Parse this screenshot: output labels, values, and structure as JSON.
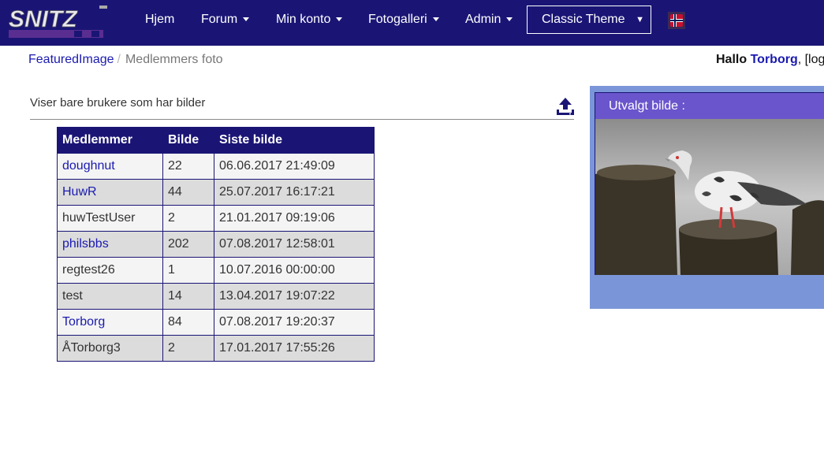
{
  "navbar": {
    "logo_text": "SNITZ",
    "items": [
      {
        "label": "Hjem",
        "has_caret": false
      },
      {
        "label": "Forum",
        "has_caret": true
      },
      {
        "label": "Min konto",
        "has_caret": true
      },
      {
        "label": "Fotogalleri",
        "has_caret": true
      },
      {
        "label": "Admin",
        "has_caret": true
      }
    ],
    "theme_select": {
      "value": "Classic Theme",
      "arrow": "▼"
    },
    "language_flag": "norway-flag-icon"
  },
  "breadcrumb": {
    "items": [
      "FeaturedImage",
      "Medlemmers foto"
    ],
    "separator": "/"
  },
  "greeting": {
    "hallo": "Hallo",
    "user": "Torborg",
    "suffix": ", [log"
  },
  "main": {
    "info_text": "Viser bare brukere som har bilder",
    "upload_icon": "upload-icon",
    "table": {
      "headers": [
        "Medlemmer",
        "Bilde",
        "Siste bilde"
      ],
      "rows": [
        {
          "name": "doughnut",
          "count": "22",
          "last": "06.06.2017 21:49:09",
          "link": true
        },
        {
          "name": "HuwR",
          "count": "44",
          "last": "25.07.2017 16:17:21",
          "link": true
        },
        {
          "name": "huwTestUser",
          "count": "2",
          "last": "21.01.2017 09:19:06",
          "link": false
        },
        {
          "name": "philsbbs",
          "count": "202",
          "last": "07.08.2017 12:58:01",
          "link": true
        },
        {
          "name": "regtest26",
          "count": "1",
          "last": "10.07.2016 00:00:00",
          "link": false
        },
        {
          "name": "test",
          "count": "14",
          "last": "13.04.2017 19:07:22",
          "link": false
        },
        {
          "name": "Torborg",
          "count": "84",
          "last": "07.08.2017 19:20:37",
          "link": true
        },
        {
          "name": "ÅTorborg3",
          "count": "2",
          "last": "17.01.2017 17:55:26",
          "link": false
        }
      ]
    }
  },
  "featured": {
    "title": "Utvalgt bilde :"
  },
  "colors": {
    "navbar": "#1a1575",
    "link": "#1a1ab0",
    "panel": "#7b96d8",
    "panel_header": "#6a55cc"
  }
}
